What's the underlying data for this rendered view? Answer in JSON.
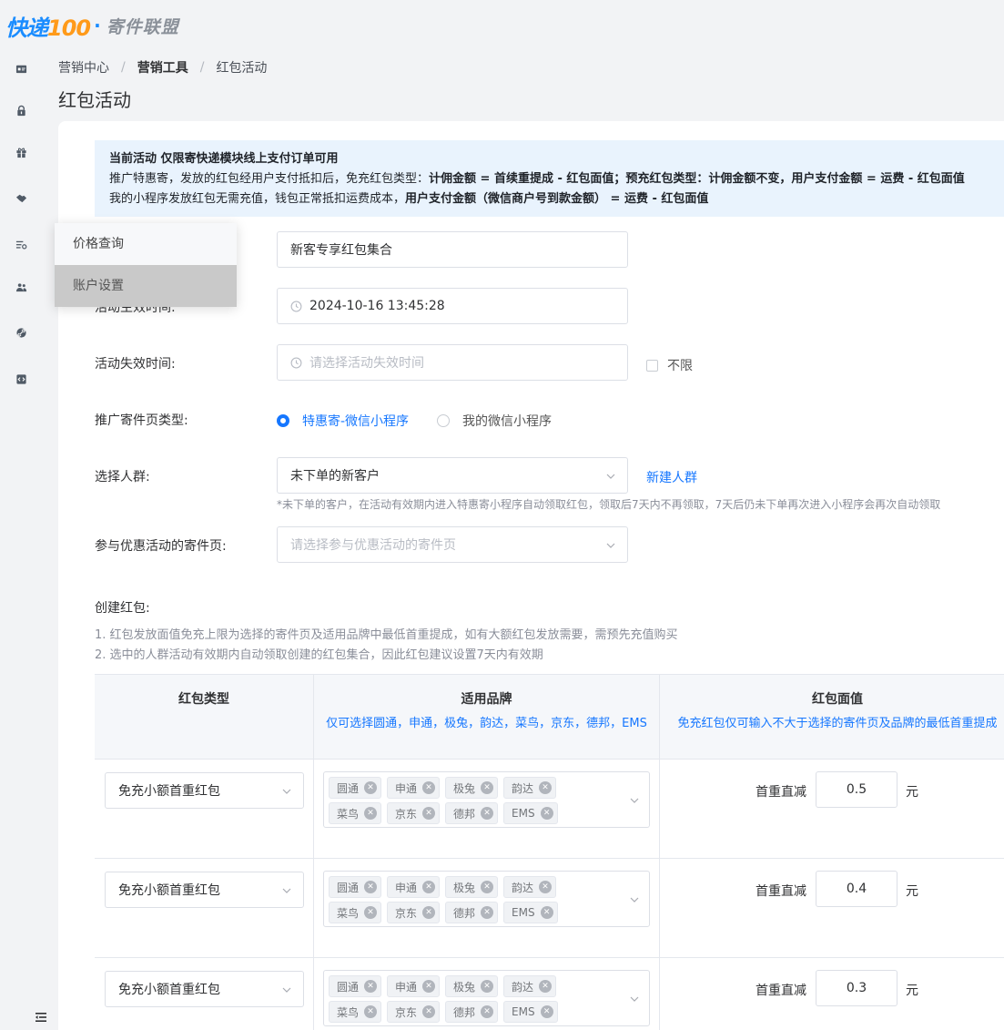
{
  "logo": {
    "brand_main": "快递",
    "brand_num": "100",
    "separator": "·",
    "subtitle": "寄件联盟"
  },
  "sidebar": {
    "icons": [
      "id-card-icon",
      "lock-icon",
      "gift-icon",
      "handshake-icon",
      "list-settings-icon",
      "users-icon",
      "link-icon",
      "code-icon"
    ]
  },
  "popup_menu": {
    "items": [
      {
        "label": "价格查询"
      },
      {
        "label": "账户设置"
      }
    ]
  },
  "breadcrumb": [
    "营销中心",
    "营销工具",
    "红包活动"
  ],
  "page_title": "红包活动",
  "notice": {
    "line1_prefix": "当前活动 ",
    "line1_bold": "仅限寄快递模块线上支付订单可用",
    "line2_a": "推广特惠寄，发放的红包经用户支付抵扣后，免充红包类型：",
    "line2_b": "计佣金额 = 首续重提成 - 红包面值；预充红包类型：计佣金额不变，用户支付金额 = 运费 - 红包面值",
    "line3_a": "我的小程序发放红包无需充值，钱包正常抵扣运费成本，",
    "line3_b": "用户支付金额（微信商户号到款金额） = 运费 - 红包面值"
  },
  "form": {
    "name": {
      "value": "新客专享红包集合"
    },
    "start_time": {
      "label": "活动生效时间:",
      "value": "2024-10-16 13:45:28"
    },
    "end_time": {
      "label": "活动失效时间:",
      "placeholder": "请选择活动失效时间",
      "unlimited_label": "不限"
    },
    "page_type": {
      "label": "推广寄件页类型:",
      "options": [
        {
          "label": "特惠寄-微信小程序",
          "selected": true
        },
        {
          "label": "我的微信小程序",
          "selected": false
        }
      ]
    },
    "crowd": {
      "label": "选择人群:",
      "value": "未下单的新客户",
      "new_link": "新建人群",
      "hint": "*未下单的客户，在活动有效期内进入特惠寄小程序自动领取红包，领取后7天内不再领取，7天后仍未下单再次进入小程序会再次自动领取"
    },
    "pages": {
      "label": "参与优惠活动的寄件页:",
      "placeholder": "请选择参与优惠活动的寄件页"
    }
  },
  "create": {
    "title": "创建红包:",
    "tips": [
      "1. 红包发放面值免充上限为选择的寄件页及适用品牌中最低首重提成，如有大额红包发放需要，需预先充值购买",
      "2. 选中的人群活动有效期内自动领取创建的红包集合，因此红包建议设置7天内有效期"
    ]
  },
  "table": {
    "headers": [
      {
        "title": "红包类型",
        "sub": ""
      },
      {
        "title": "适用品牌",
        "sub": "仅可选择圆通，申通，极兔，韵达，菜鸟，京东，德邦，EMS"
      },
      {
        "title": "红包面值",
        "sub": "免充红包仅可输入不大于选择的寄件页及品牌的最低首重提成"
      }
    ],
    "rows": [
      {
        "type": "免充小额首重红包",
        "brands": [
          "圆通",
          "申通",
          "极兔",
          "韵达",
          "菜鸟",
          "京东",
          "德邦",
          "EMS"
        ],
        "face_label": "首重直减",
        "face_value": "0.5",
        "unit": "元"
      },
      {
        "type": "免充小额首重红包",
        "brands": [
          "圆通",
          "申通",
          "极兔",
          "韵达",
          "菜鸟",
          "京东",
          "德邦",
          "EMS"
        ],
        "face_label": "首重直减",
        "face_value": "0.4",
        "unit": "元"
      },
      {
        "type": "免充小额首重红包",
        "brands": [
          "圆通",
          "申通",
          "极兔",
          "韵达",
          "菜鸟",
          "京东",
          "德邦",
          "EMS"
        ],
        "face_label": "首重直减",
        "face_value": "0.3",
        "unit": "元"
      }
    ]
  },
  "colors": {
    "primary": "#1677ff",
    "notice_bg": "#e9f3fd",
    "logo_blue": "#1a8cff",
    "logo_orange": "#ff9a1a"
  }
}
